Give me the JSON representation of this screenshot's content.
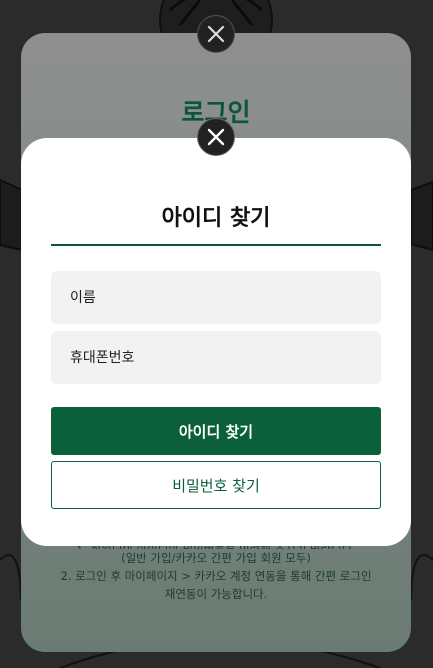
{
  "background_modal": {
    "title": "로그인",
    "notes": [
      "1. 회원님의 아이디와 비밀번호를 입력해 주시기 바랍니다.",
      "(일반 가입/카카오 간편 가입 회원 모두)",
      "2. 로그인 후 마이페이지 > 카카오 계정 연동을 통해 간편 로그인",
      "재연동이 가능합니다."
    ]
  },
  "find_id_modal": {
    "title": "아이디 찾기",
    "fields": {
      "name_placeholder": "이름",
      "phone_placeholder": "휴대폰번호"
    },
    "buttons": {
      "find_id": "아이디 찾기",
      "find_password": "비밀번호 찾기"
    }
  },
  "colors": {
    "brand_green": "#0b5f3b",
    "field_bg": "#f2f2f2",
    "overlay": "#2b2b2b"
  },
  "icons": {
    "close": "close-icon"
  }
}
